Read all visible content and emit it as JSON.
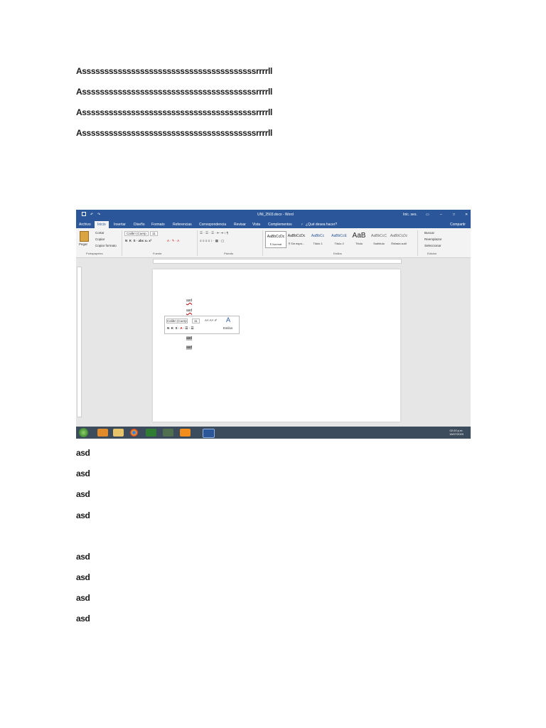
{
  "document": {
    "top_lines": [
      "Asssssssssssssssssssssssssssssssssssssssrrrrll",
      "Asssssssssssssssssssssssssssssssssssssssrrrrll",
      "Asssssssssssssssssssssssssssssssssssssssrrrrll",
      "Asssssssssssssssssssssssssssssssssssssssrrrrll"
    ],
    "bottom_lines": [
      "asd",
      "asd",
      "asd",
      "asd",
      "asd",
      "asd",
      "asd",
      "asd"
    ]
  },
  "screenshot": {
    "window_title": "UNI_2503.docx - Word",
    "user": "Inic. ses.",
    "tabs": [
      "Archivo",
      "Inicio",
      "Insertar",
      "Diseño",
      "Formato",
      "Referencias",
      "Correspondencia",
      "Revisar",
      "Vista",
      "Complementos"
    ],
    "tell_me": "¿Qué desea hacer?",
    "share": "Compartir",
    "clipboard": {
      "paste": "Pegar",
      "cut": "Cortar",
      "copy": "Copiar",
      "format_painter": "Copiar formato",
      "group": "Portapapeles"
    },
    "font": {
      "name": "Calibri (Cuerp",
      "size": "11",
      "group": "Fuente"
    },
    "paragraph_group": "Párrafo",
    "styles": [
      {
        "sample": "AaBbCcDc",
        "label": "¶ Normal"
      },
      {
        "sample": "AaBbCcDc",
        "label": "¶ Sin espa..."
      },
      {
        "sample": "AaBbCc",
        "label": "Título 1"
      },
      {
        "sample": "AaBbCcE",
        "label": "Título 2"
      },
      {
        "sample": "AaB",
        "label": "Título"
      },
      {
        "sample": "AaBbCcC",
        "label": "Subtítulo"
      },
      {
        "sample": "AaBbCcDc",
        "label": "Énfasis sutil"
      }
    ],
    "styles_group": "Estilos",
    "editing": {
      "find": "Buscar",
      "replace": "Reemplazar",
      "select": "Seleccionar",
      "group": "Edición"
    },
    "page_lines": [
      "asd",
      "asd",
      "asd",
      "asd"
    ],
    "mini_toolbar": {
      "font": "Calibri (Cuerp",
      "size": "11",
      "styles": "Estilos"
    },
    "clock": {
      "time": "02:20 p.m.",
      "date": "15/07/2020"
    }
  }
}
